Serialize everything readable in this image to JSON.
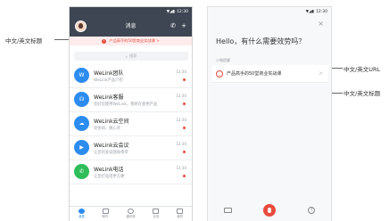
{
  "annotations": {
    "left_title": "中文/英文标题",
    "right_url": "中文/英文URL",
    "right_title": "中文/英文标题"
  },
  "phone1": {
    "status_time": "12:30",
    "title": "消息",
    "banner_text": "产品高手的50堂商业实战课 >",
    "search_placeholder": "搜索",
    "items": [
      {
        "title": "WeLink团队",
        "sub": "WeLink产品介绍",
        "time": "12:30",
        "icon_color": "#2d8cf0",
        "icon_text": "W"
      },
      {
        "title": "WeLink客服",
        "sub": "您好您使用WeLink，我将在使用产品",
        "time": "12:30",
        "icon_color": "#2d8cf0",
        "icon_text": "☊"
      },
      {
        "title": "WeLink云空间",
        "sub": "轻协同、随心享",
        "time": "12:30",
        "icon_color": "#2d8cf0",
        "icon_text": "☁"
      },
      {
        "title": "WeLink云会议",
        "sub": "让您的会议随身携带",
        "time": "12:30",
        "icon_color": "#2d8cf0",
        "icon_text": "▶"
      },
      {
        "title": "WeLink电话",
        "sub": "让您打电话更方便",
        "time": "12:30",
        "icon_color": "#2ebd59",
        "icon_text": "✆"
      }
    ],
    "tabs": [
      {
        "label": "消息",
        "active": true
      },
      {
        "label": "邮件",
        "active": false
      },
      {
        "label": "通讯录",
        "active": false
      },
      {
        "label": "业务",
        "active": false
      },
      {
        "label": "我的",
        "active": false
      }
    ]
  },
  "phone2": {
    "status_time": "12:30",
    "close": "×",
    "heading": "Hello，有什么需要效劳吗？",
    "section_label": "小微提醒",
    "card_title": "产品高手的50堂商业实战课",
    "card_arrow": ">"
  }
}
